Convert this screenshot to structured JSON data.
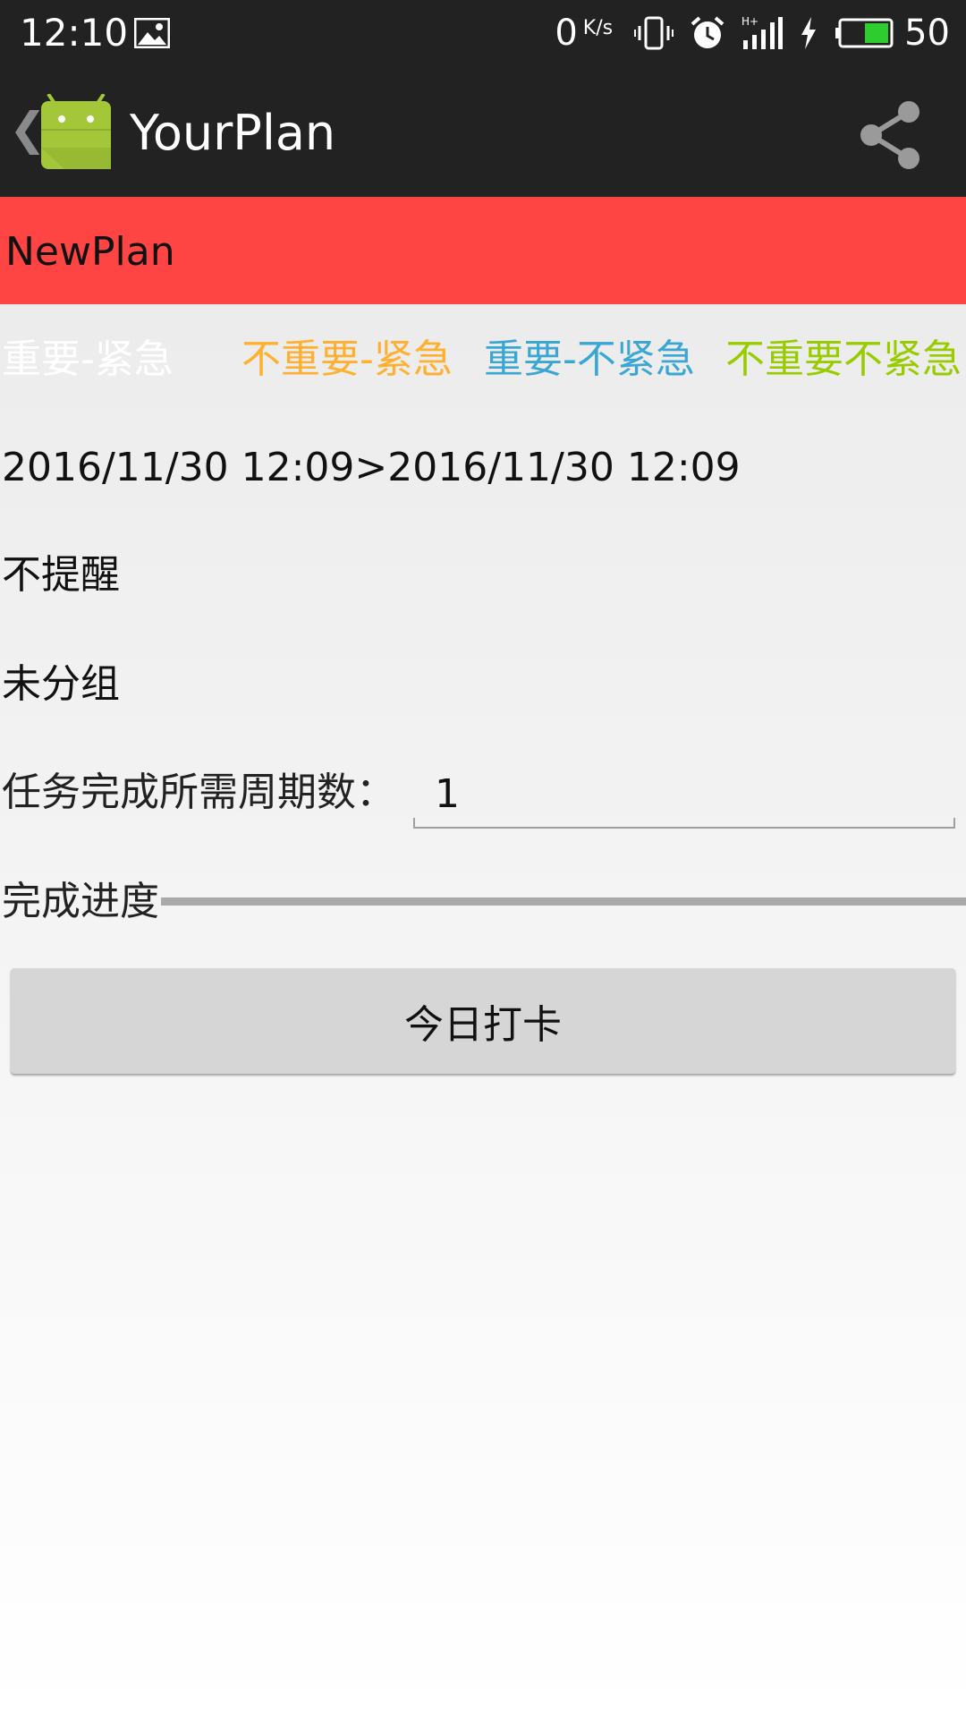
{
  "status_bar": {
    "time": "12:10",
    "net_speed": "0",
    "net_speed_unit": "K/s",
    "battery_percent": "50",
    "icons": [
      "image-icon",
      "vibrate-icon",
      "alarm-icon",
      "signal-icon",
      "charging-icon",
      "battery-icon"
    ]
  },
  "action_bar": {
    "title": "YourPlan",
    "back_glyph": "❮",
    "icons": [
      "back-chevron-icon",
      "android-logo-icon",
      "share-icon"
    ]
  },
  "plan": {
    "title": "NewPlan",
    "header_color": "#ff4444"
  },
  "priority_options": [
    {
      "label": "重要-紧急",
      "color": "#ffffff"
    },
    {
      "label": "不重要-紧急",
      "color": "#ffb031"
    },
    {
      "label": "重要-不紧急",
      "color": "#3aa6d4"
    },
    {
      "label": "不重要不紧急",
      "color": "#99cc00"
    }
  ],
  "date_range": "2016/11/30 12:09>2016/11/30 12:09",
  "reminder": "不提醒",
  "group": "未分组",
  "cycles": {
    "label": "任务完成所需周期数：",
    "value": "1"
  },
  "progress": {
    "label": "完成进度",
    "fraction": 0
  },
  "checkin_button": "今日打卡"
}
